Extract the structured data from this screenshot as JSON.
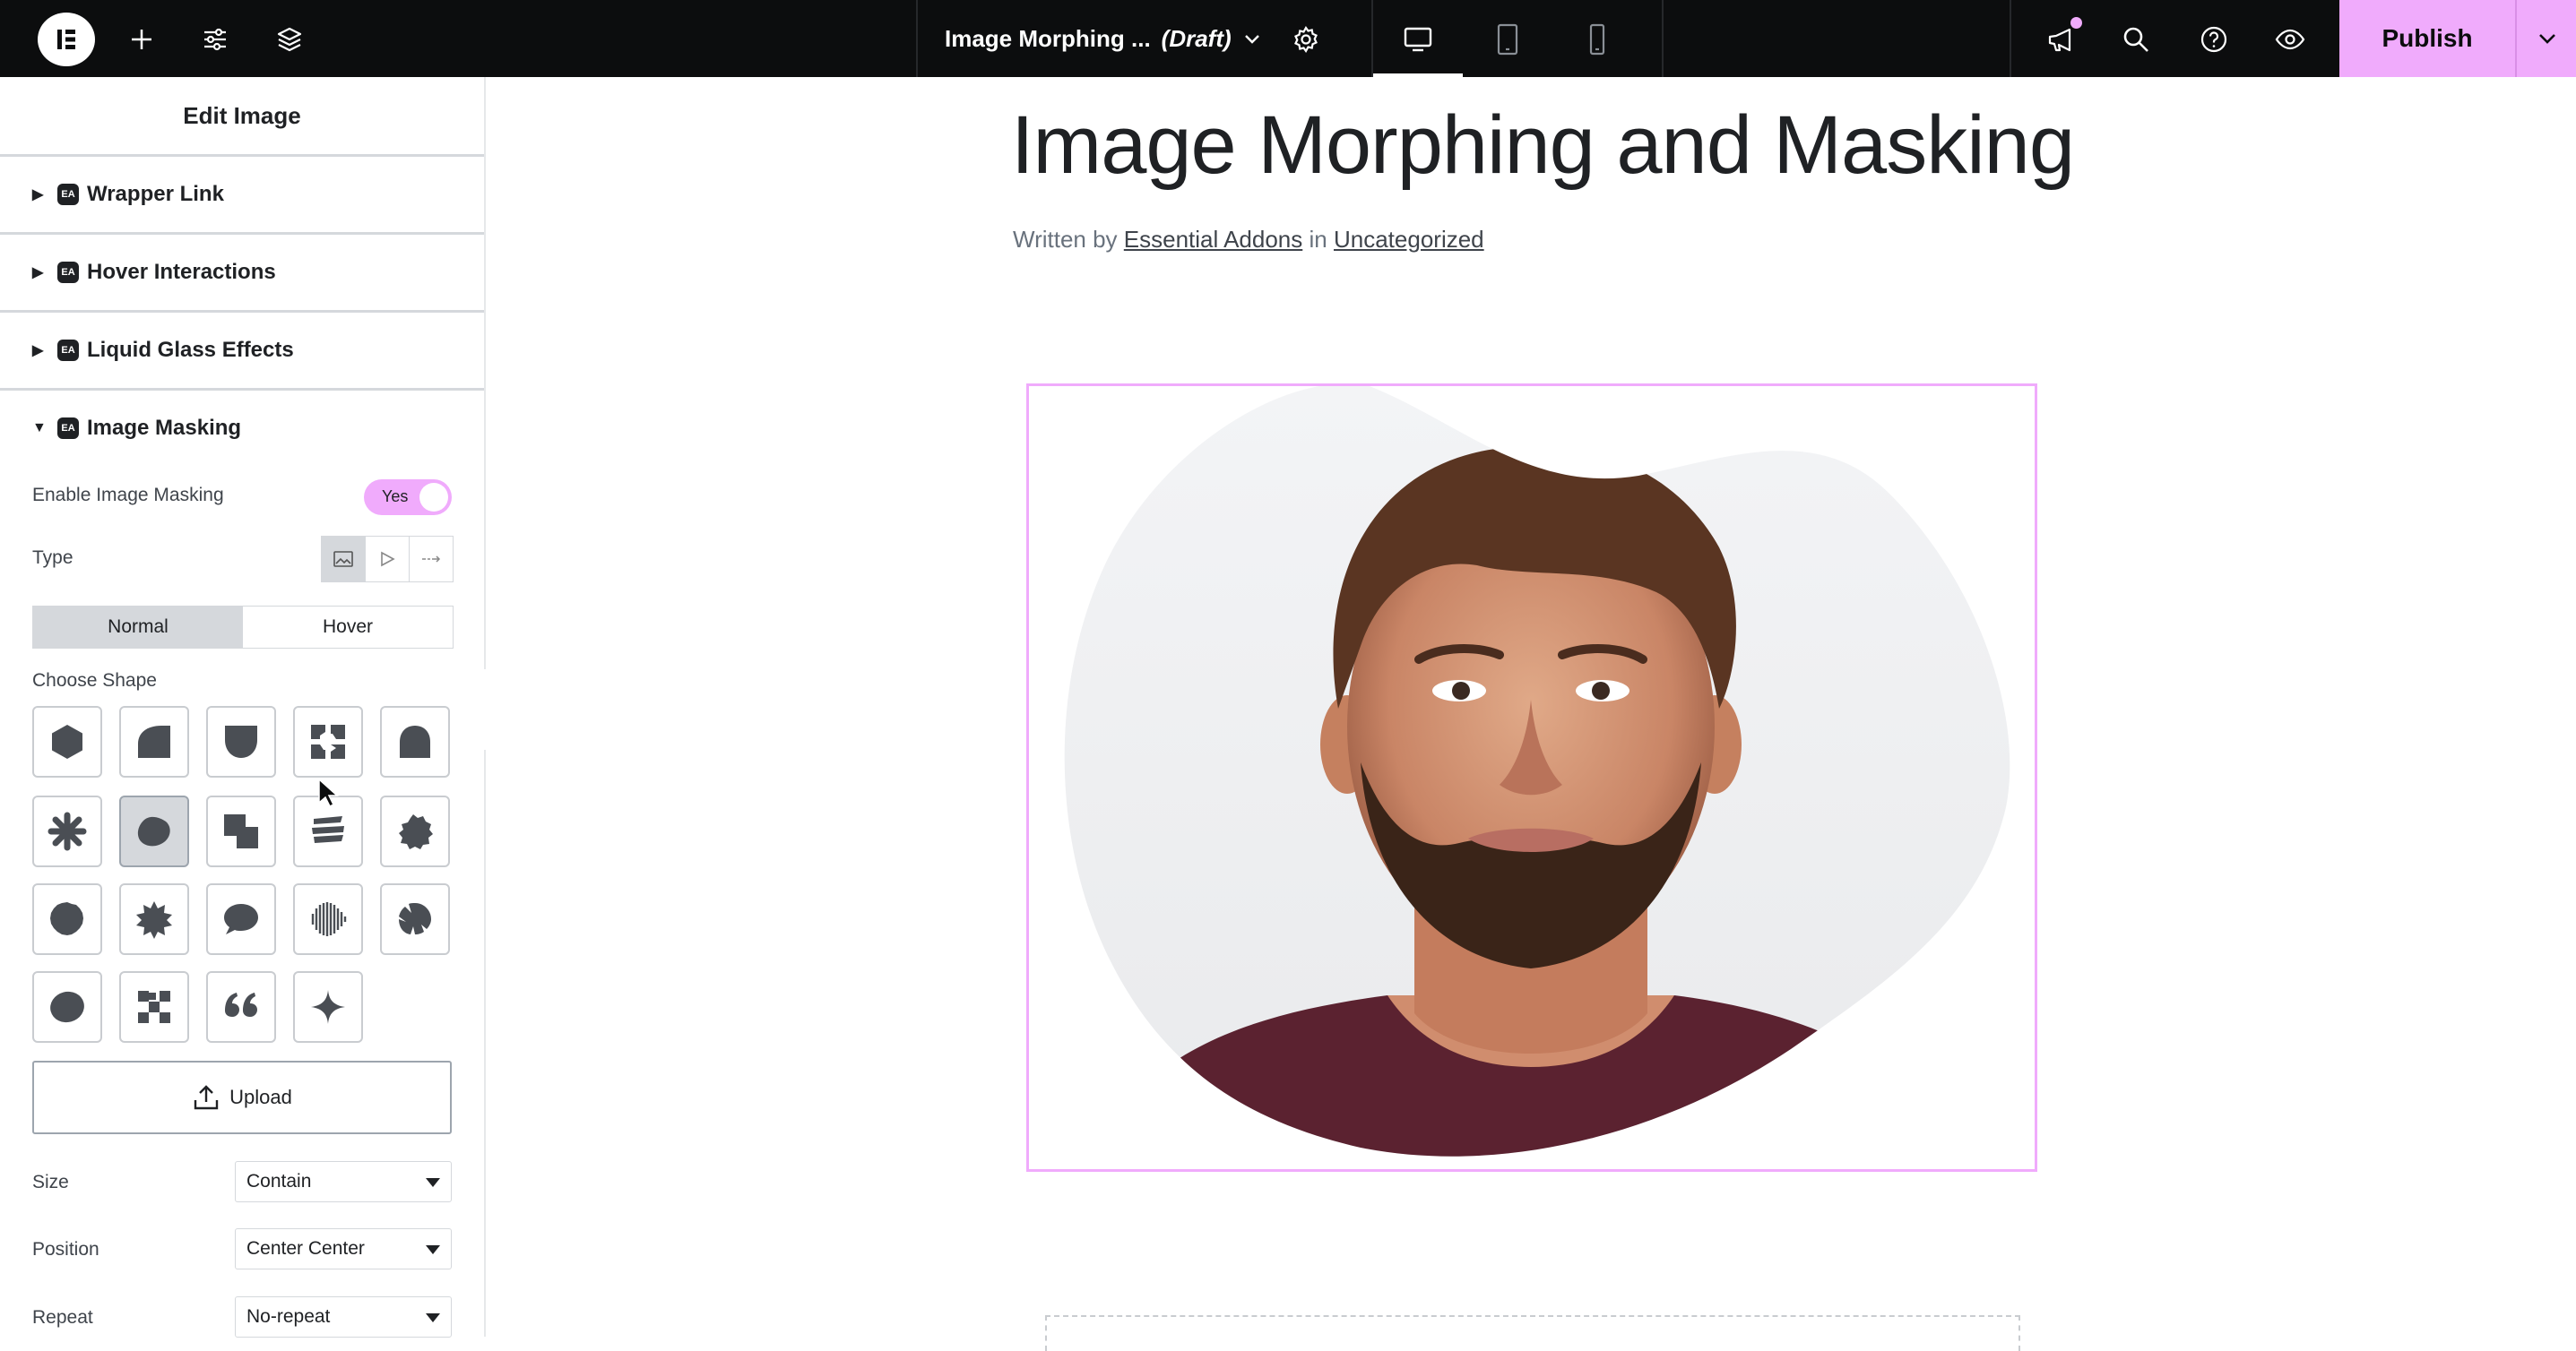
{
  "topbar": {
    "page_name": "Image Morphing ...",
    "status": "(Draft)",
    "publish_label": "Publish",
    "icons": [
      "elementor-logo-icon",
      "plus-icon",
      "sliders-icon",
      "layers-icon",
      "chevron-down-icon",
      "gear-icon",
      "desktop-icon",
      "tablet-icon",
      "mobile-icon",
      "megaphone-icon",
      "search-icon",
      "help-icon",
      "eye-icon"
    ],
    "accent": "#f0abfc"
  },
  "panel": {
    "title": "Edit Image",
    "badge": "EA",
    "sections": [
      {
        "label": "Wrapper Link",
        "open": false
      },
      {
        "label": "Hover Interactions",
        "open": false
      },
      {
        "label": "Liquid Glass Effects",
        "open": false
      },
      {
        "label": "Image Masking",
        "open": true
      }
    ],
    "enable_label": "Enable Image Masking",
    "enable_value": "Yes",
    "type_label": "Type",
    "tabs": [
      "Normal",
      "Hover"
    ],
    "choose_shape_label": "Choose Shape",
    "upload_label": "Upload",
    "size": {
      "label": "Size",
      "value": "Contain"
    },
    "position": {
      "label": "Position",
      "value": "Center Center"
    },
    "repeat": {
      "label": "Repeat",
      "value": "No-repeat"
    }
  },
  "canvas": {
    "post_title": "Image Morphing and Masking",
    "written_by": "Written by",
    "author": "Essential Addons",
    "in_word": "in",
    "category": "Uncategorized"
  }
}
